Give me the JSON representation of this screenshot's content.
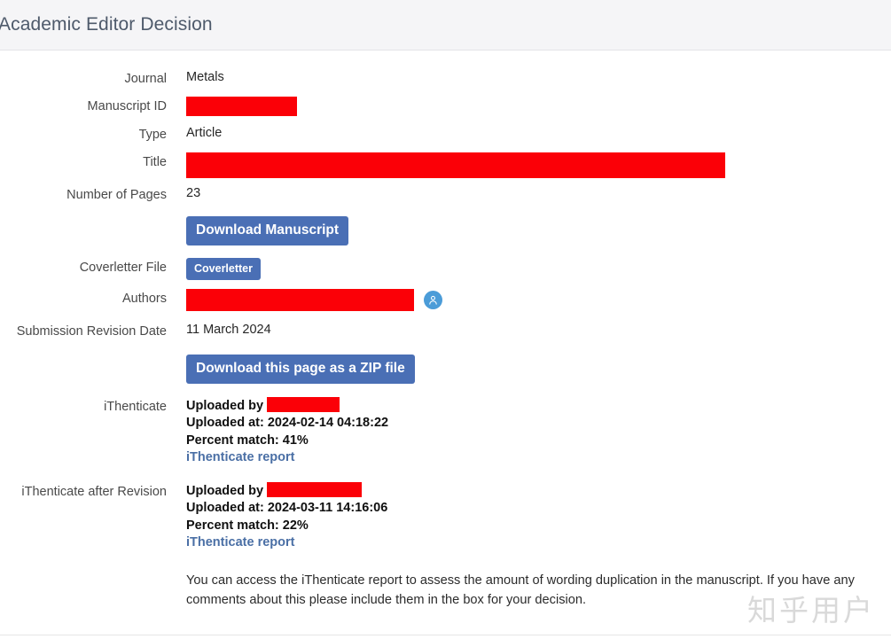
{
  "header": {
    "title": "Academic Editor Decision"
  },
  "fields": {
    "journal_label": "Journal",
    "journal_value": "Metals",
    "manuscript_id_label": "Manuscript ID",
    "manuscript_id_value": "",
    "type_label": "Type",
    "type_value": "Article",
    "title_label": "Title",
    "title_value": "",
    "pages_label": "Number of Pages",
    "pages_value": "23",
    "coverletter_label": "Coverletter File",
    "authors_label": "Authors",
    "authors_value": "",
    "submission_revision_date_label": "Submission Revision Date",
    "submission_revision_date_value": "11 March 2024",
    "ithenticate_label": "iThenticate",
    "ithenticate_after_revision_label": "iThenticate after Revision"
  },
  "buttons": {
    "download_manuscript": "Download Manuscript",
    "coverletter": "Coverletter",
    "download_zip": "Download this page as a ZIP file"
  },
  "ithenticate": {
    "uploaded_by_label": "Uploaded by",
    "uploaded_at": "Uploaded at: 2024-02-14 04:18:22",
    "percent_match": "Percent match: 41%",
    "report_link": "iThenticate report"
  },
  "ithenticate_after_revision": {
    "uploaded_by_label": "Uploaded by",
    "uploaded_at": "Uploaded at: 2024-03-11 14:16:06",
    "percent_match": "Percent match: 22%",
    "report_link": "iThenticate report"
  },
  "note": {
    "text": "You can access the iThenticate report to assess the amount of wording duplication in the manuscript. If you have any comments about this please include them in the box for your decision."
  },
  "watermark": {
    "text": "知乎用户"
  },
  "colors": {
    "redaction": "#fb0007",
    "button_blue": "#4a6fb5",
    "link_blue": "#4a6fa5",
    "header_bg": "#f5f5f7",
    "header_title": "#4e5a6b",
    "avatar_blue": "#4b9cd8"
  }
}
